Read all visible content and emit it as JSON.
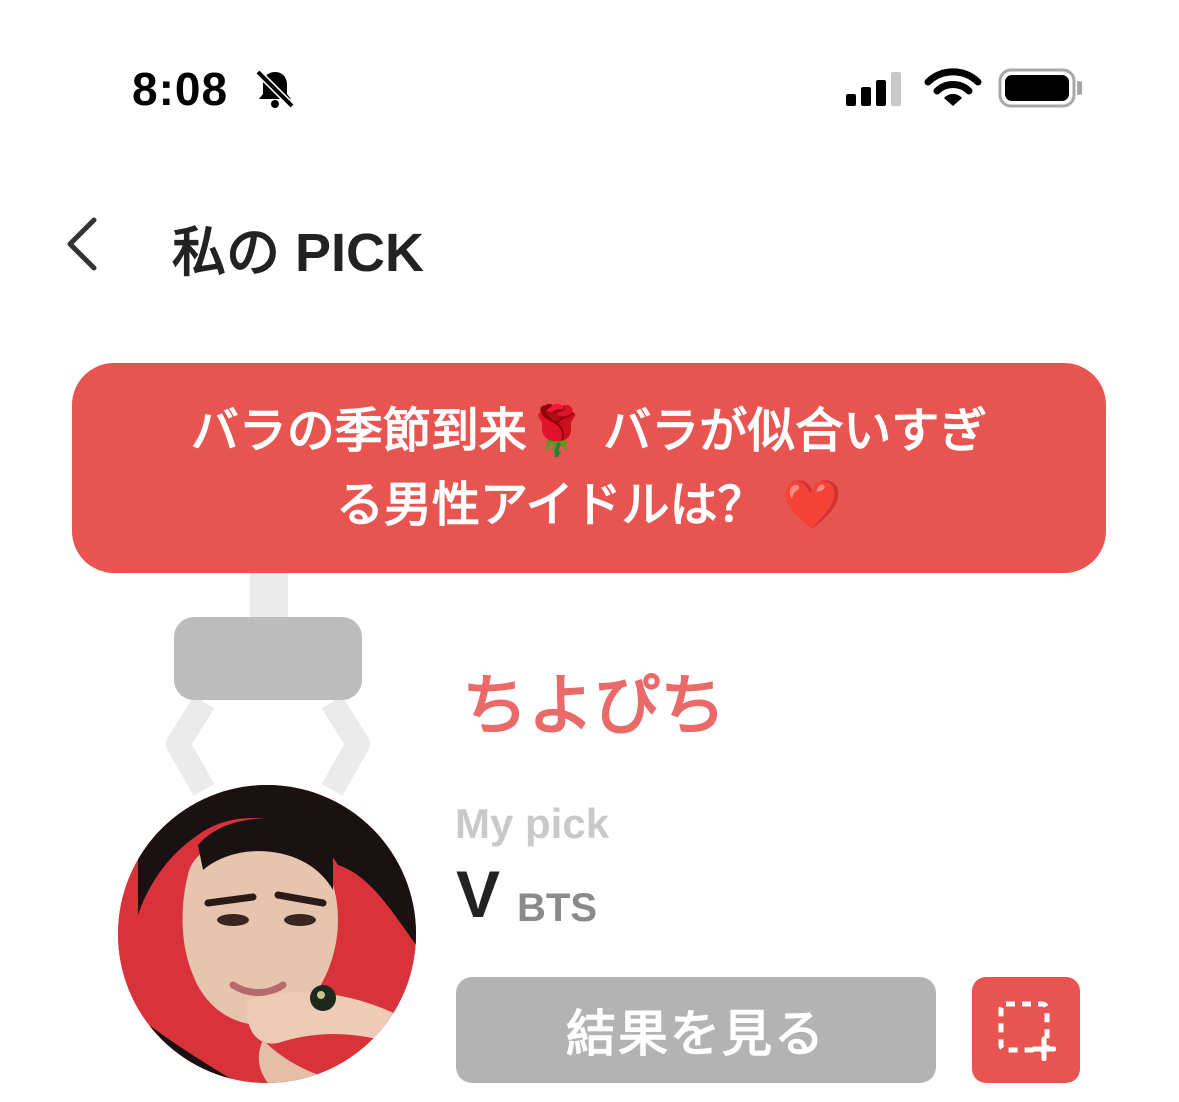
{
  "status_bar": {
    "time": "8:08",
    "icons": [
      "bell-slash-icon",
      "cellular-signal-icon",
      "wifi-icon",
      "battery-icon"
    ]
  },
  "header": {
    "back_icon": "chevron-left-icon",
    "title": "私の PICK"
  },
  "question": {
    "line1": "バラの季節到来🌹 バラが似合いすぎ",
    "line2": "る男性アイドルは？ ❤️"
  },
  "user": {
    "name": "ちよぴち"
  },
  "pick": {
    "label": "My pick",
    "name": "V",
    "group": "BTS"
  },
  "buttons": {
    "result_label": "結果を見る",
    "capture_icon": "screenshot-add-icon"
  },
  "colors": {
    "accent": "#e85450",
    "username": "#ea6a6a",
    "button_gray": "#b3b3b3",
    "claw_gray": "#bcbcbc"
  }
}
